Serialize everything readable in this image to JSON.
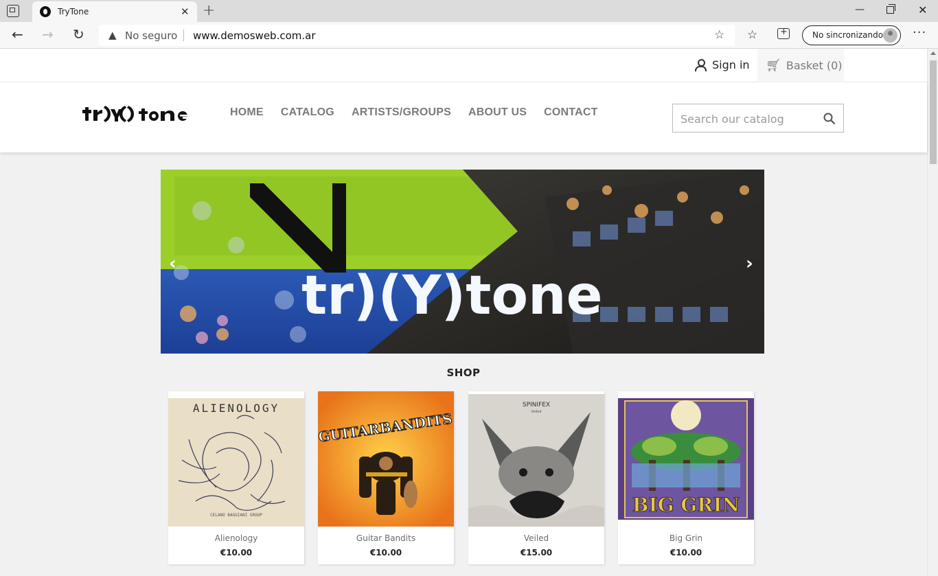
{
  "browser": {
    "tab_title": "TryTone",
    "security_label": "No seguro",
    "url": "www.demosweb.com.ar",
    "profile_label": "No sincronizando"
  },
  "site": {
    "signin_label": "Sign in",
    "basket_label": "Basket (0)",
    "nav": [
      "HOME",
      "CATALOG",
      "ARTISTS/GROUPS",
      "ABOUT US",
      "CONTACT"
    ],
    "search_placeholder": "Search our catalog",
    "hero_logo_text": "tr)(Y)tone",
    "shop_title": "SHOP",
    "products": [
      {
        "name": "Alienology",
        "price": "€10.00",
        "cover_text": "ALIENOLOGY",
        "cover_subtext": "CELANO BAGGIANI GROUP"
      },
      {
        "name": "Guitar Bandits",
        "price": "€10.00",
        "cover_text": "GUITARBANDITS"
      },
      {
        "name": "Veiled",
        "price": "€15.00",
        "cover_text": "SPINIFEX",
        "cover_subtext": "Veiled"
      },
      {
        "name": "Big Grin",
        "price": "€10.00",
        "cover_text": "BIG GRIN"
      }
    ]
  },
  "colors": {
    "nav_text": "#7a7a7a",
    "hero_green": "#9ccf2a",
    "hero_blue": "#2f64c7"
  },
  "icons": [
    "tab-actions-icon",
    "favicon-icon",
    "close-icon",
    "plus-icon",
    "back-icon",
    "forward-icon",
    "reload-icon",
    "warning-icon",
    "add-favorite-icon",
    "favorites-icon",
    "collections-icon",
    "more-icon",
    "user-icon",
    "cart-icon",
    "search-icon",
    "chevron-left-icon",
    "chevron-right-icon"
  ]
}
